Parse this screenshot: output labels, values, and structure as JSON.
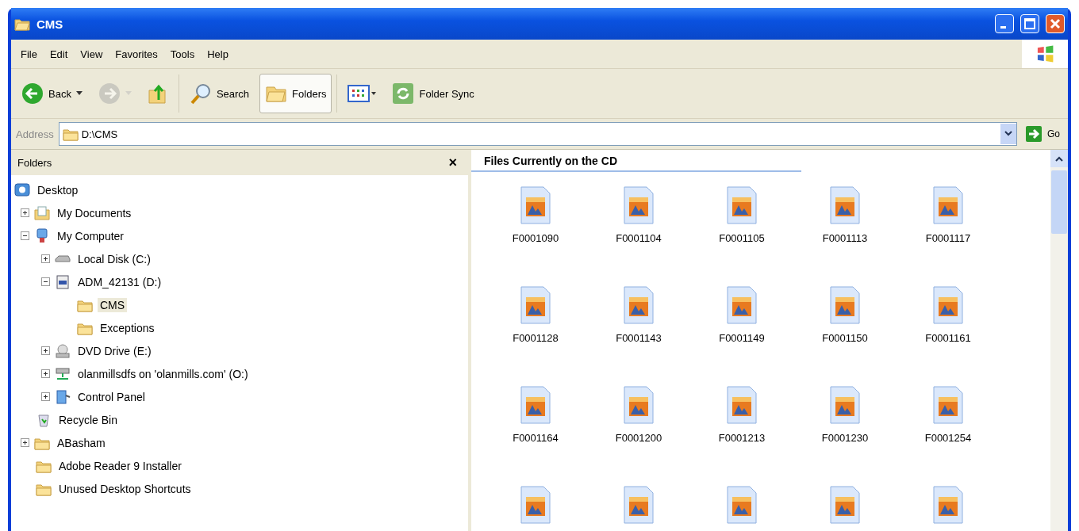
{
  "window": {
    "title": "CMS"
  },
  "menu": [
    "File",
    "Edit",
    "View",
    "Favorites",
    "Tools",
    "Help"
  ],
  "toolbar": [
    {
      "kind": "back",
      "label": "Back",
      "disabled": false,
      "selected": false
    },
    {
      "kind": "forward",
      "disabled": true,
      "selected": false
    },
    {
      "kind": "up",
      "disabled": false,
      "selected": false
    },
    {
      "kind": "search",
      "label": "Search",
      "disabled": false,
      "selected": false
    },
    {
      "kind": "folders",
      "label": "Folders",
      "disabled": false,
      "selected": true
    },
    {
      "kind": "views",
      "disabled": false,
      "selected": false
    },
    {
      "kind": "sync",
      "label": "Folder Sync",
      "disabled": false,
      "selected": false
    }
  ],
  "address": {
    "label": "Address",
    "value": "D:\\CMS",
    "go": "Go"
  },
  "folders_pane": {
    "title": "Folders",
    "close": "×",
    "tree": [
      {
        "label": "Desktop",
        "kind": "desktop",
        "selected": false,
        "children": [
          {
            "label": "My Documents",
            "kind": "documents",
            "expanded": false,
            "selected": false
          },
          {
            "label": "My Computer",
            "kind": "computer",
            "expanded": true,
            "selected": false,
            "children": [
              {
                "label": "Local Disk (C:)",
                "kind": "disk",
                "expanded": false,
                "selected": false
              },
              {
                "label": "ADM_42131 (D:)",
                "kind": "cd",
                "expanded": true,
                "selected": false,
                "children": [
                  {
                    "label": "CMS",
                    "kind": "folder",
                    "selected": true
                  },
                  {
                    "label": "Exceptions",
                    "kind": "folder",
                    "selected": false
                  }
                ]
              },
              {
                "label": "DVD Drive (E:)",
                "kind": "dvd",
                "expanded": false,
                "selected": false
              },
              {
                "label": "olanmillsdfs on 'olanmills.com' (O:)",
                "kind": "network",
                "expanded": false,
                "selected": false
              },
              {
                "label": "Control Panel",
                "kind": "panel",
                "expanded": false,
                "selected": false
              }
            ]
          },
          {
            "label": "Recycle Bin",
            "kind": "recycle",
            "selected": false
          },
          {
            "label": "ABasham",
            "kind": "folder",
            "expanded": false,
            "selected": false
          },
          {
            "label": "Adobe Reader 9 Installer",
            "kind": "folder",
            "selected": false
          },
          {
            "label": "Unused Desktop Shortcuts",
            "kind": "folder",
            "selected": false
          }
        ]
      }
    ]
  },
  "files": {
    "heading": "Files Currently on the CD",
    "items": [
      {
        "kind": "file",
        "name": "F0001090"
      },
      {
        "kind": "file",
        "name": "F0001104"
      },
      {
        "kind": "file",
        "name": "F0001105"
      },
      {
        "kind": "file",
        "name": "F0001113"
      },
      {
        "kind": "file",
        "name": "F0001117"
      },
      {
        "kind": "file",
        "name": "F0001128"
      },
      {
        "kind": "file",
        "name": "F0001143"
      },
      {
        "kind": "file",
        "name": "F0001149"
      },
      {
        "kind": "file",
        "name": "F0001150"
      },
      {
        "kind": "file",
        "name": "F0001161"
      },
      {
        "kind": "file",
        "name": "F0001164"
      },
      {
        "kind": "file",
        "name": "F0001200"
      },
      {
        "kind": "file",
        "name": "F0001213"
      },
      {
        "kind": "file",
        "name": "F0001230"
      },
      {
        "kind": "file",
        "name": "F0001254"
      },
      {
        "kind": "partial"
      },
      {
        "kind": "partial"
      },
      {
        "kind": "partial"
      },
      {
        "kind": "partial"
      },
      {
        "kind": "partial"
      }
    ]
  }
}
